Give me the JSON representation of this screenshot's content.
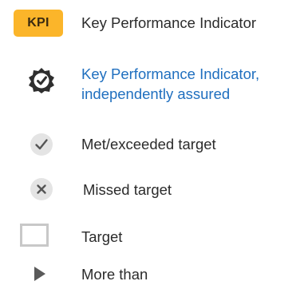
{
  "legend": {
    "items": [
      {
        "symbol": "kpi-badge",
        "badge_text": "KPI",
        "label": "Key Performance Indicator"
      },
      {
        "symbol": "assured-gear-check-icon",
        "label_line1": "Key Performance Indicator,",
        "label_line2": "independently assured"
      },
      {
        "symbol": "checkmark-icon",
        "label": "Met/exceeded target"
      },
      {
        "symbol": "cross-icon",
        "label": "Missed target"
      },
      {
        "symbol": "target-box-icon",
        "label": "Target"
      },
      {
        "symbol": "right-arrow-icon",
        "label": "More than"
      }
    ]
  },
  "colors": {
    "kpi_badge": "#fbb52a",
    "link_blue": "#1f6fbf",
    "text": "#2b2b2b",
    "symbol_grey": "#e2e2e2"
  }
}
